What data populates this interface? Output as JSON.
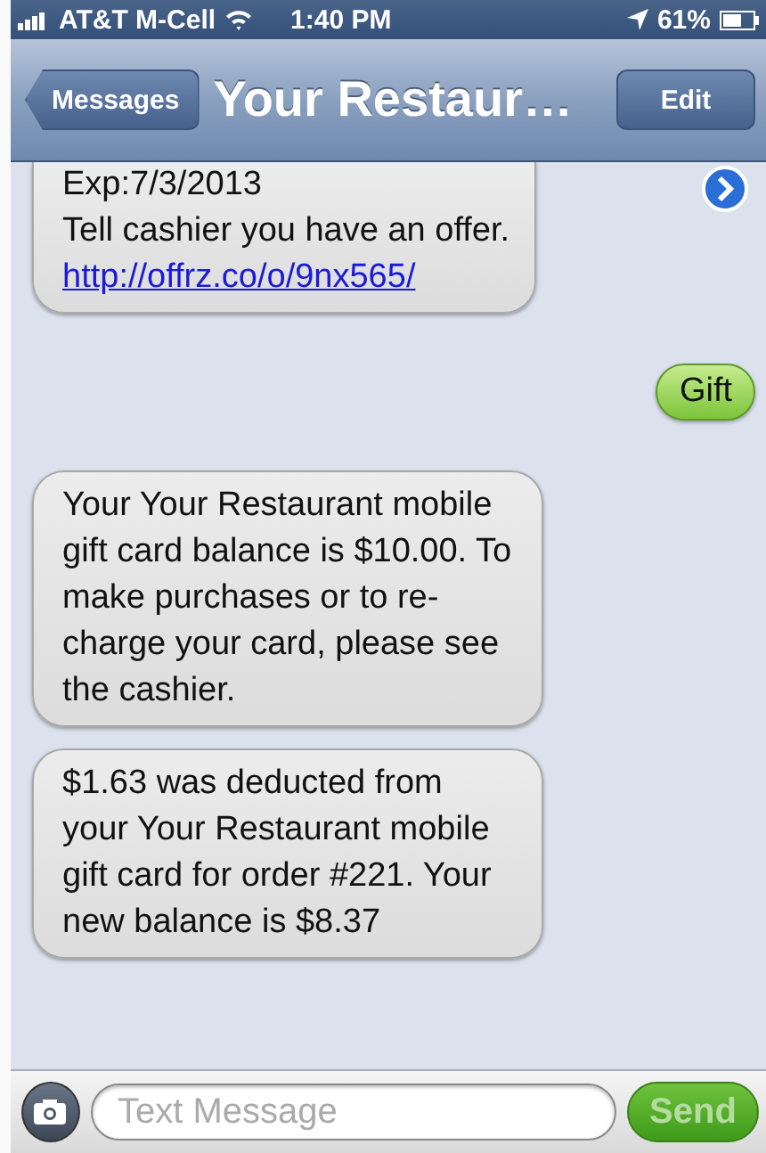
{
  "status_bar": {
    "carrier": "AT&T M-Cell",
    "time": "1:40 PM",
    "battery": "61%"
  },
  "nav_bar": {
    "back": "Messages",
    "title": "Your Restaur…",
    "action": "Edit"
  },
  "messages": [
    {
      "kind": "incoming",
      "text": "Exp:7/3/2013\nTell cashier you have an offer.",
      "link": "http://offrz.co/o/9nx565/"
    },
    {
      "kind": "outgoing",
      "text": "Gift"
    },
    {
      "kind": "incoming",
      "text": "Your Your Restaurant mobile gift card balance is $10.00. To make purchases or to re-charge your card, please see the cashier."
    },
    {
      "kind": "incoming",
      "text": "$1.63 was deducted from your Your Restaurant mobile gift card for order #221. Your new balance is $8.37"
    }
  ],
  "compose": {
    "placeholder": "Text Message",
    "send": "Send",
    "send_disabled": true
  }
}
